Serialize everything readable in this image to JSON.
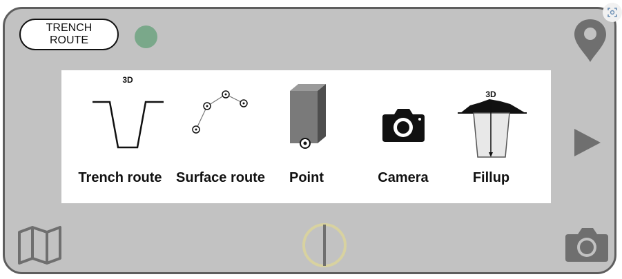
{
  "header": {
    "route_line1": "TRENCH",
    "route_line2": "ROUTE"
  },
  "tools": [
    {
      "label": "Trench route",
      "badge": "3D",
      "icon": "trench-icon"
    },
    {
      "label": "Surface route",
      "icon": "surface-route-icon"
    },
    {
      "label": "Point",
      "icon": "point-box-icon"
    },
    {
      "label": "Camera",
      "icon": "camera-icon"
    },
    {
      "label": "Fillup",
      "badge": "3D",
      "icon": "fillup-icon"
    }
  ],
  "controls": {
    "top_right": "location-pin-icon",
    "right_middle": "play-icon",
    "bottom_left": "map-icon",
    "bottom_center": "capture-ring-icon",
    "bottom_right": "camera-icon"
  },
  "colors": {
    "device_bg": "#c2c2c2",
    "device_border": "#5e5e5e",
    "status_dot": "#7aa88a",
    "icon_gray": "#6f6f6f",
    "ring": "#d8d2a0"
  }
}
